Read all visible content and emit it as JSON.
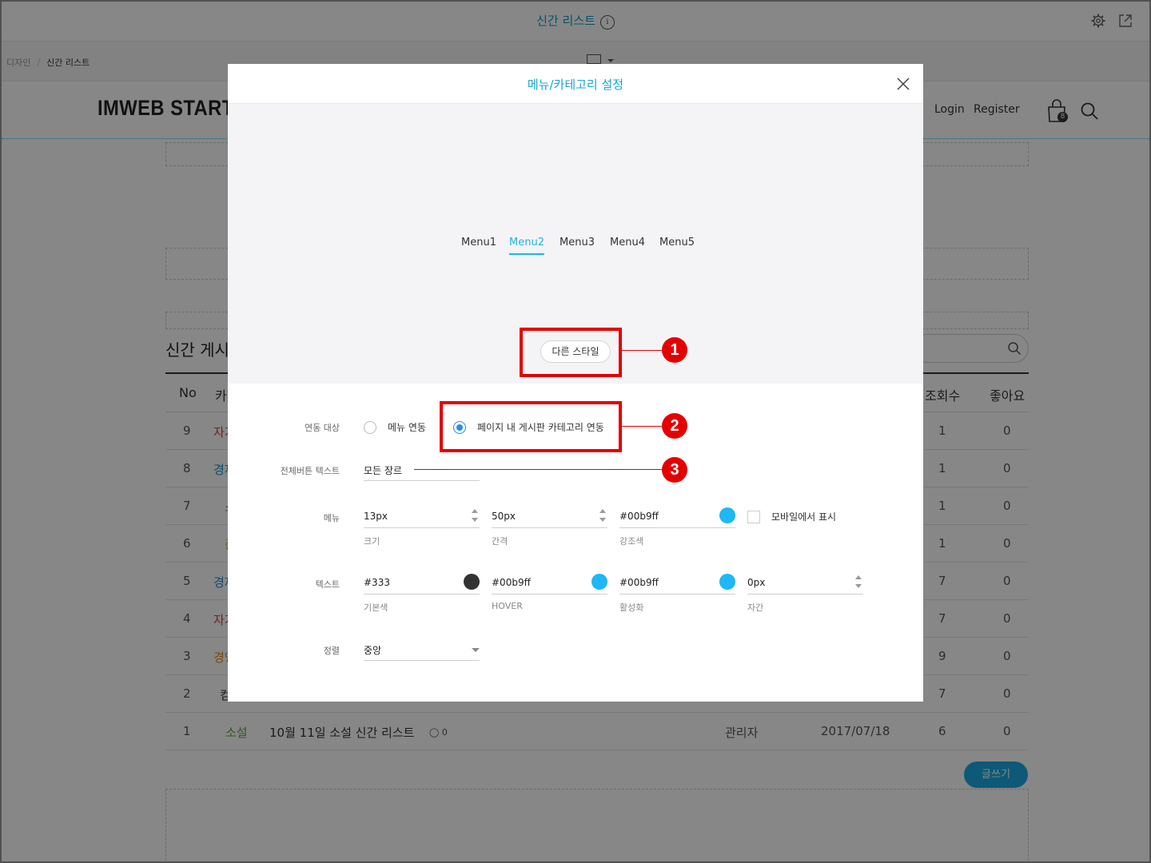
{
  "editor": {
    "page_title": "신간 리스트",
    "info_icon": "i",
    "breadcrumb": {
      "parent": "디자인",
      "separator": "/",
      "current": "신간 리스트"
    }
  },
  "site": {
    "logo": "IMWEB STARTER",
    "nav": {
      "login": "Login",
      "register": "Register"
    },
    "cart_count": "8"
  },
  "board": {
    "title": "신간 게시판",
    "headers": {
      "no": "No",
      "category": "카테고리",
      "views": "조회수",
      "likes": "좋아요"
    },
    "rows": [
      {
        "no": "9",
        "category": "자기",
        "views": "1",
        "likes": "0"
      },
      {
        "no": "8",
        "category": "경제",
        "views": "1",
        "likes": "0"
      },
      {
        "no": "7",
        "category": "소",
        "views": "1",
        "likes": "0"
      },
      {
        "no": "6",
        "category": "종",
        "views": "1",
        "likes": "0"
      },
      {
        "no": "5",
        "category": "경제",
        "views": "7",
        "likes": "0"
      },
      {
        "no": "4",
        "category": "자기",
        "views": "7",
        "likes": "0"
      },
      {
        "no": "3",
        "category": "경영",
        "views": "9",
        "likes": "0"
      },
      {
        "no": "2",
        "category": "컴",
        "views": "7",
        "likes": "0"
      }
    ],
    "last_row": {
      "no": "1",
      "category": "소설",
      "title": "10월 11일 소설 신간 리스트",
      "comments": "0",
      "author": "관리자",
      "date": "2017/07/18",
      "views": "6",
      "likes": "0"
    },
    "write_button": "글쓰기"
  },
  "modal": {
    "title": "메뉴/카테고리 설정",
    "preview_menus": [
      "Menu1",
      "Menu2",
      "Menu3",
      "Menu4",
      "Menu5"
    ],
    "active_menu": "Menu2",
    "style_button": "다른 스타일",
    "link_target": {
      "label": "연동 대상",
      "option_menu": "메뉴 연동",
      "option_board": "페이지 내 게시판 카테고리 연동",
      "selected": "페이지 내 게시판 카테고리 연동"
    },
    "all_button_text": {
      "label": "전체버튼 텍스트",
      "value": "모든 장르"
    },
    "menu": {
      "label": "메뉴",
      "size": {
        "value": "13px",
        "caption": "크기"
      },
      "gap": {
        "value": "50px",
        "caption": "간격"
      },
      "accent": {
        "value": "#00b9ff",
        "caption": "강조색"
      },
      "mobile_label": "모바일에서 표시",
      "mobile_checked": false
    },
    "text": {
      "label": "텍스트",
      "base": {
        "value": "#333",
        "caption": "기본색"
      },
      "hover": {
        "value": "#00b9ff",
        "caption": "HOVER"
      },
      "active": {
        "value": "#00b9ff",
        "caption": "활성화"
      },
      "spacing": {
        "value": "0px",
        "caption": "자간"
      }
    },
    "align": {
      "label": "정렬",
      "value": "중앙"
    }
  },
  "callouts": [
    "1",
    "2",
    "3"
  ],
  "colors": {
    "accent": "#00b9ff",
    "title_blue": "#15a5d6",
    "radio_blue": "#2a8af0",
    "callout_red": "#e50000",
    "text_base": "#333333"
  }
}
